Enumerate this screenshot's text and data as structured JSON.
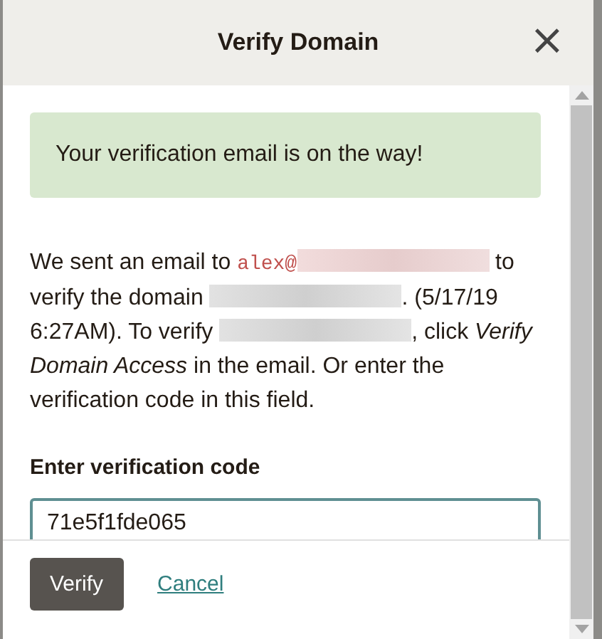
{
  "dialog": {
    "title": "Verify Domain",
    "close": "×"
  },
  "alert": "Your verification email is on the way!",
  "message": [
    {
      "kind": "text",
      "text": "We sent an email to "
    },
    {
      "kind": "email",
      "text": "alex@"
    },
    {
      "kind": "redacted"
    },
    {
      "kind": "text",
      "text": " to verify the domain "
    },
    {
      "kind": "redacted"
    },
    {
      "kind": "text",
      "text": ". (5/17/19 6:27AM). To verify "
    },
    {
      "kind": "redacted"
    },
    {
      "kind": "text",
      "text": ", click *Verify Domain Access* in the email. Or enter the verification code in this field."
    }
  ],
  "code_field": {
    "label": "Enter verification code",
    "value": "71e5f1fde065"
  },
  "buttons": {
    "primary": "Verify",
    "secondary": "Cancel"
  }
}
